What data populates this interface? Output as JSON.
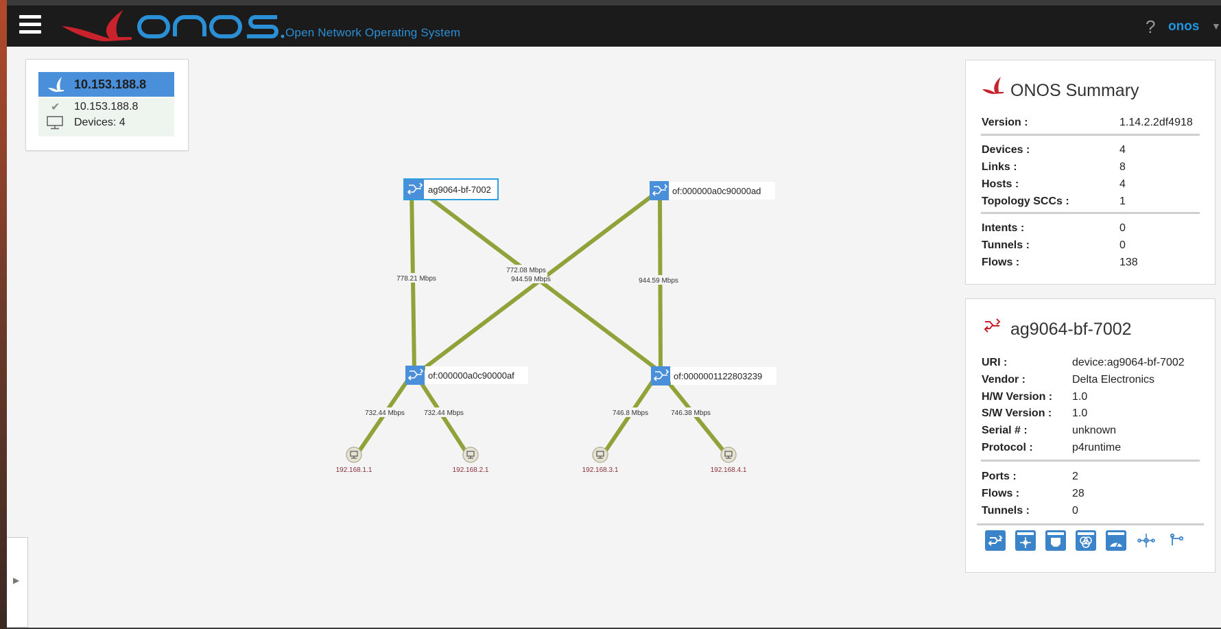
{
  "masthead": {
    "tagline": "Open Network Operating System",
    "help_icon": "question-icon",
    "user": "onos"
  },
  "cluster": {
    "head_ip": "10.153.188.8",
    "node_ip": "10.153.188.8",
    "devices": "Devices: 4"
  },
  "topology": {
    "devices": [
      {
        "name": "ag9064-bf-7002",
        "selected": true
      },
      {
        "name": "of:000000a0c90000ad",
        "selected": false
      },
      {
        "name": "of:000000a0c90000af",
        "selected": false
      },
      {
        "name": "of:0000001122803239",
        "selected": false
      }
    ],
    "link_labels": [
      "778.21 Mbps",
      "772.08 Mbps",
      "944.59 Mbps",
      "944.59 Mbps",
      "732.44 Mbps",
      "732.44 Mbps",
      "746.8 Mbps",
      "746.38 Mbps"
    ],
    "hosts": [
      "192.168.1.1",
      "192.168.2.1",
      "192.168.3.1",
      "192.168.4.1"
    ],
    "link_color": "#8fa33a"
  },
  "summary": {
    "title": "ONOS Summary",
    "version_k": "Version :",
    "version_v": "1.14.2.2df4918",
    "devices_k": "Devices :",
    "devices_v": "4",
    "links_k": "Links :",
    "links_v": "8",
    "hosts_k": "Hosts :",
    "hosts_v": "4",
    "sccs_k": "Topology SCCs :",
    "sccs_v": "1",
    "intents_k": "Intents :",
    "intents_v": "0",
    "tunnels_k": "Tunnels :",
    "tunnels_v": "0",
    "flows_k": "Flows :",
    "flows_v": "138"
  },
  "detail": {
    "title": "ag9064-bf-7002",
    "uri_k": "URI :",
    "uri_v": "device:ag9064-bf-7002",
    "vendor_k": "Vendor :",
    "vendor_v": "Delta Electronics",
    "hw_k": "H/W Version :",
    "hw_v": "1.0",
    "sw_k": "S/W Version :",
    "sw_v": "1.0",
    "serial_k": "Serial # :",
    "serial_v": "unknown",
    "protocol_k": "Protocol :",
    "protocol_v": "p4runtime",
    "ports_k": "Ports :",
    "ports_v": "2",
    "flows_k": "Flows :",
    "flows_v": "28",
    "tunnels_k": "Tunnels :",
    "tunnels_v": "0",
    "buttons": [
      "device-table-icon",
      "flow-table-icon",
      "port-table-icon",
      "group-table-icon",
      "meter-table-icon",
      "pipeconf-icon",
      "relatedIntents-icon"
    ]
  },
  "colors": {
    "accent": "#1f97e0",
    "panel_head": "#4a8fd9",
    "brand_red": "#c8222d"
  }
}
